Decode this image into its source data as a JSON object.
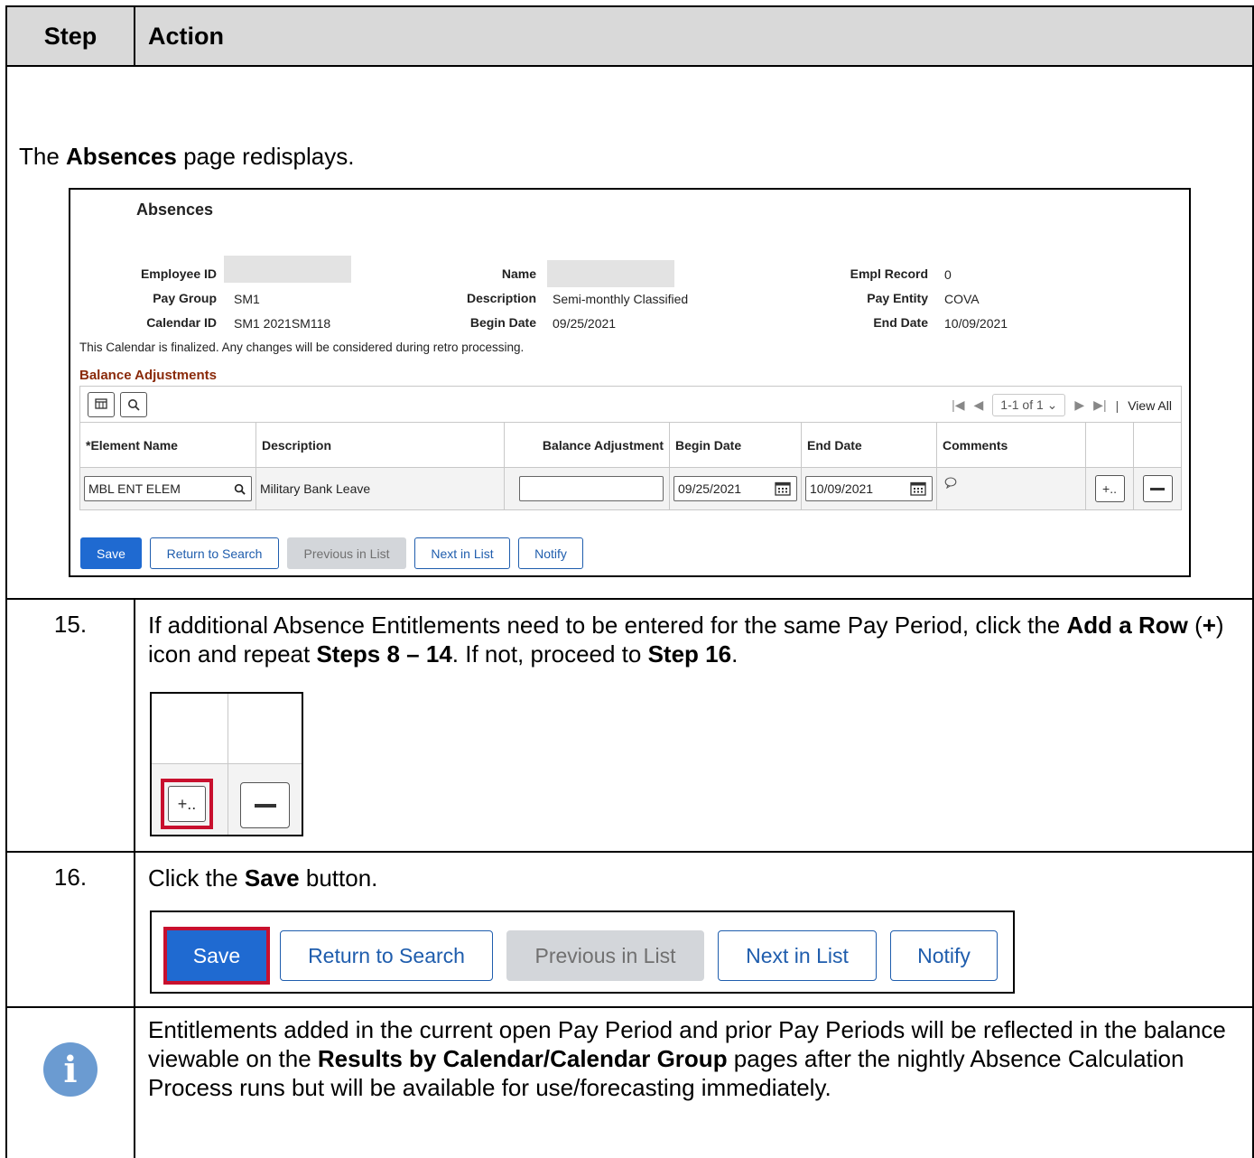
{
  "table_header": {
    "step": "Step",
    "action": "Action"
  },
  "intro": {
    "pre": "The ",
    "bold": "Absences",
    "post": " page redisplays."
  },
  "absences": {
    "title": "Absences",
    "employee_id_label": "Employee ID",
    "name_label": "Name",
    "empl_record_label": "Empl Record",
    "empl_record_value": "0",
    "pay_group_label": "Pay Group",
    "pay_group_value": "SM1",
    "description_label": "Description",
    "description_value": "Semi-monthly Classified",
    "pay_entity_label": "Pay Entity",
    "pay_entity_value": "COVA",
    "calendar_id_label": "Calendar ID",
    "calendar_id_value": "SM1 2021SM118",
    "begin_date_label": "Begin Date",
    "begin_date_value": "09/25/2021",
    "end_date_label": "End Date",
    "end_date_value": "10/09/2021",
    "finalized_note": "This Calendar is finalized. Any changes will be considered during retro processing.",
    "balance_adjustments": "Balance Adjustments",
    "pager": "1-1 of 1",
    "view_all": "View All",
    "columns": [
      "*Element Name",
      "Description",
      "Balance Adjustment",
      "Begin Date",
      "End Date",
      "Comments"
    ],
    "row": {
      "element_name": "MBL ENT ELEM",
      "description": "Military Bank Leave",
      "balance_adjustment": "",
      "begin_date": "09/25/2021",
      "end_date": "10/09/2021"
    },
    "add_row_glyph": "+..",
    "buttons": {
      "save": "Save",
      "return": "Return to Search",
      "previous": "Previous in List",
      "next": "Next in List",
      "notify": "Notify"
    }
  },
  "step15": {
    "number": "15.",
    "t1": "If additional Absence Entitlements need to be entered for the same Pay Period, click the ",
    "b1": "Add a Row",
    "t2": " (",
    "b2": "+",
    "t3": ") icon and repeat ",
    "b3": "Steps 8 – 14",
    "t4": ". If not, proceed to ",
    "b4": "Step 16",
    "t5": "."
  },
  "step16": {
    "number": "16.",
    "t1": "Click the ",
    "b1": "Save",
    "t2": " button."
  },
  "info": {
    "icon": "info-icon",
    "t1": "Entitlements added in the current open Pay Period and prior Pay Periods will be reflected in the balance viewable on the ",
    "b1": "Results by Calendar/Calendar Group",
    "t2": " pages after the nightly Absence Calculation Process runs but will be available for use/forecasting immediately."
  }
}
